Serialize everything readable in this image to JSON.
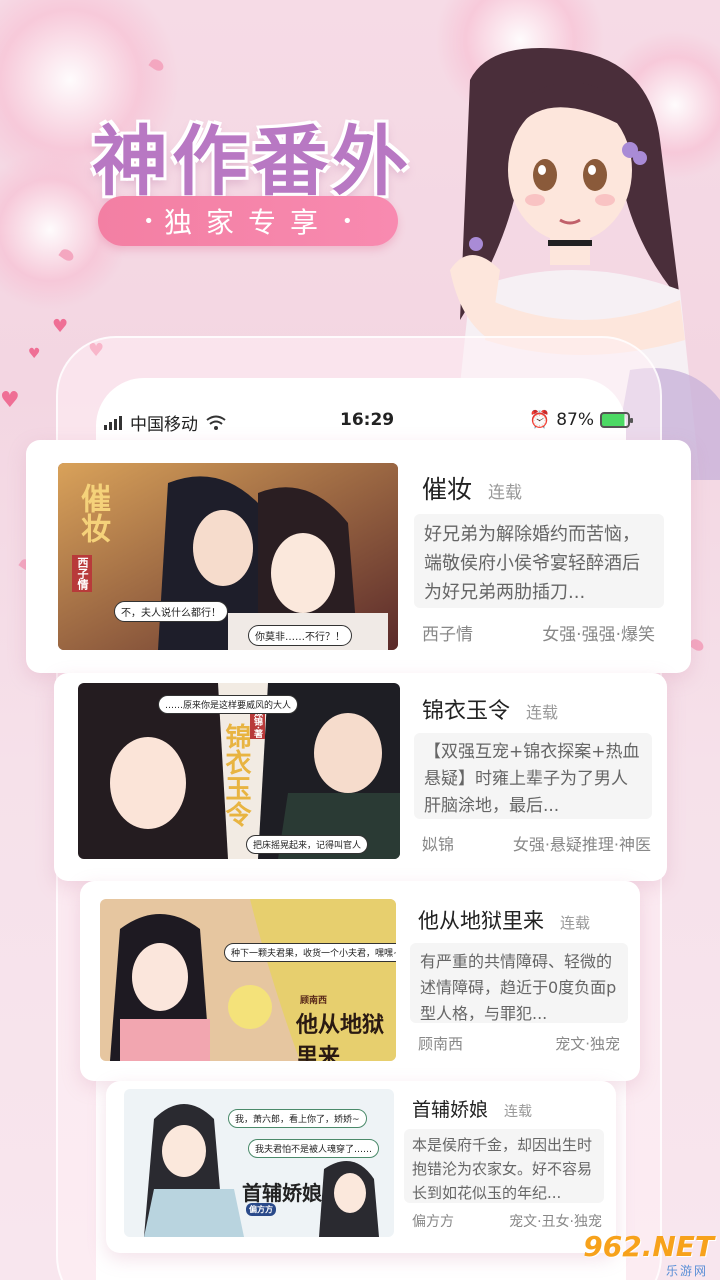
{
  "banner": {
    "headline": "神作番外",
    "tagline": "独家专享"
  },
  "status_bar": {
    "carrier": "中国移动",
    "time": "16:29",
    "battery": "87%"
  },
  "comics": [
    {
      "title": "催妆",
      "status": "连载",
      "description": "好兄弟为解除婚约而苦恼，端敬侯府小侯爷宴轻醉酒后为好兄弟两肋插刀...",
      "author": "西子情",
      "tags": "女强·强强·爆笑",
      "cover_title": "催妆",
      "cover_author": "西子情",
      "cover_bubbles": [
        "不，夫人说什么都行！",
        "你莫非……不行？！"
      ]
    },
    {
      "title": "锦衣玉令",
      "status": "连载",
      "description": "【双强互宠+锦衣探案+热血悬疑】时雍上辈子为了男人肝脑涂地，最后...",
      "author": "姒锦",
      "tags": "女强·悬疑推理·神医",
      "cover_title": "锦衣玉令",
      "cover_author": "姒锦·著",
      "cover_bubbles": [
        "……原来你是这样要威风的大人",
        "把床摇晃起来，记得叫官人"
      ]
    },
    {
      "title": "他从地狱里来",
      "status": "连载",
      "description": "有严重的共情障碍、轻微的述情障碍，趋近于0度负面p型人格，与罪犯...",
      "author": "顾南西",
      "tags": "宠文·独宠",
      "cover_title": "他从地狱里来",
      "cover_author": "顾南西",
      "cover_bubbles": [
        "种下一颗夫君果，收货一个小夫君，嘿嘿~"
      ]
    },
    {
      "title": "首辅娇娘",
      "status": "连载",
      "description": "本是侯府千金，却因出生时抱错沦为农家女。好不容易长到如花似玉的年纪...",
      "author": "偏方方",
      "tags": "宠文·丑女·独宠",
      "cover_title": "首辅娇娘",
      "cover_author": "偏方方",
      "cover_bubbles": [
        "我，萧六郎，看上你了，娇娇~",
        "我夫君怕不是被人魂穿了……"
      ]
    }
  ],
  "watermark": {
    "brand": "962.NET",
    "site": "乐游网"
  },
  "colors": {
    "headline": "#b878c3",
    "tagline_bg": "#f37fa3",
    "background": "#f6dbe6"
  }
}
